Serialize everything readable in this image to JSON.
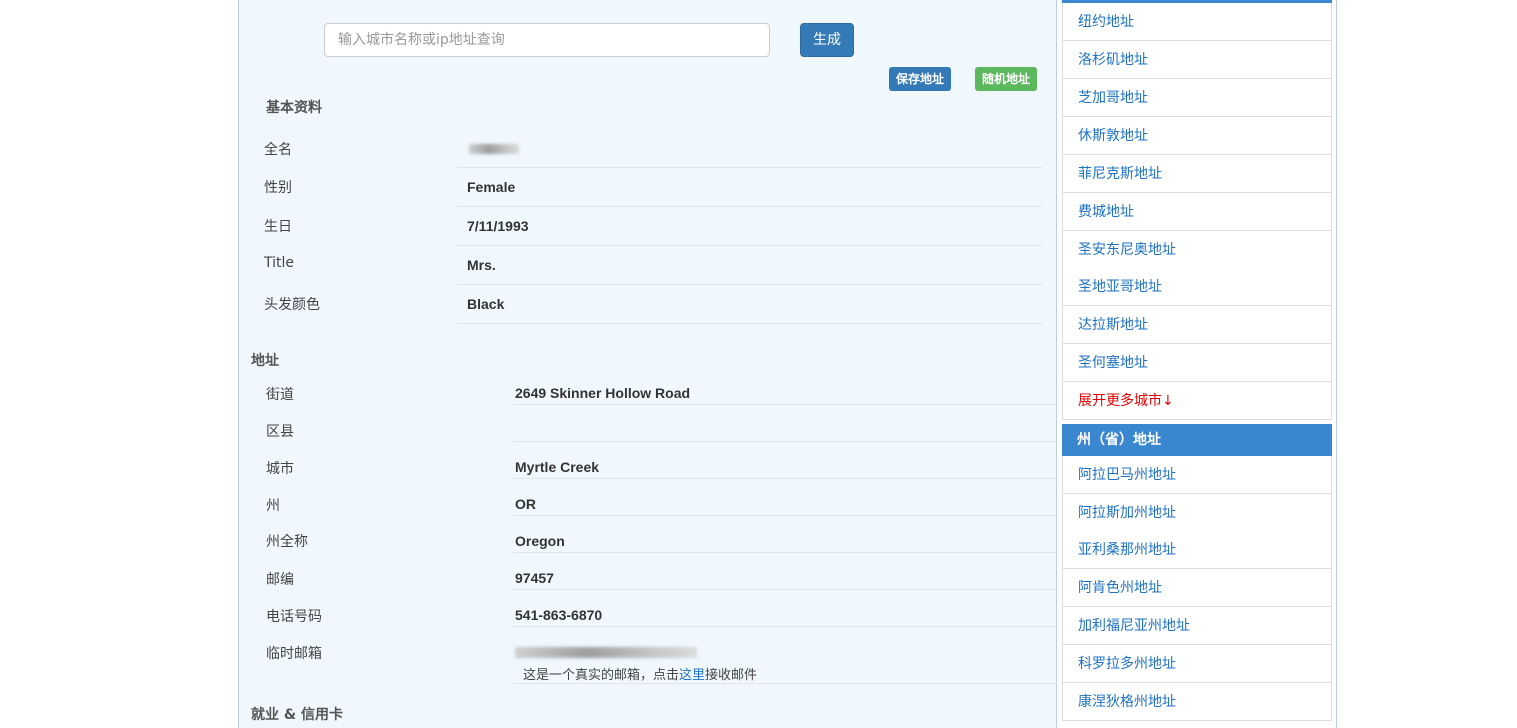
{
  "search": {
    "placeholder": "输入城市名称或ip地址查询",
    "generate_label": "生成"
  },
  "actions": {
    "save_label": "保存地址",
    "random_label": "随机地址"
  },
  "basic": {
    "title": "基本资料",
    "fields": [
      {
        "label": "全名",
        "value": ""
      },
      {
        "label": "性别",
        "value": "Female"
      },
      {
        "label": "生日",
        "value": "7/11/1993"
      },
      {
        "label": "Title",
        "value": "Mrs."
      },
      {
        "label": "头发颜色",
        "value": "Black"
      }
    ]
  },
  "address": {
    "title": "地址",
    "fields": [
      {
        "label": "街道",
        "value": "2649  Skinner Hollow Road"
      },
      {
        "label": "区县",
        "value": ""
      },
      {
        "label": "城市",
        "value": "Myrtle Creek"
      },
      {
        "label": "州",
        "value": "OR"
      },
      {
        "label": "州全称",
        "value": "Oregon"
      },
      {
        "label": "邮编",
        "value": "97457"
      },
      {
        "label": "电话号码",
        "value": "541-863-6870"
      },
      {
        "label": "临时邮箱",
        "value": ""
      }
    ],
    "email_note_prefix": "这是一个真实的邮箱，点击",
    "email_note_link": "这里",
    "email_note_suffix": "接收邮件"
  },
  "employment": {
    "title": "就业 & 信用卡"
  },
  "sidebar": {
    "cities": [
      "纽约地址",
      "洛杉矶地址",
      "芝加哥地址",
      "休斯敦地址",
      "菲尼克斯地址",
      "费城地址",
      "圣安东尼奥地址",
      "圣地亚哥地址",
      "达拉斯地址",
      "圣何塞地址"
    ],
    "more_cities": "展开更多城市↓",
    "state_header": "州（省）地址",
    "states": [
      "阿拉巴马州地址",
      "阿拉斯加州地址",
      "亚利桑那州地址",
      "阿肯色州地址",
      "加利福尼亚州地址",
      "科罗拉多州地址",
      "康涅狄格州地址"
    ]
  }
}
